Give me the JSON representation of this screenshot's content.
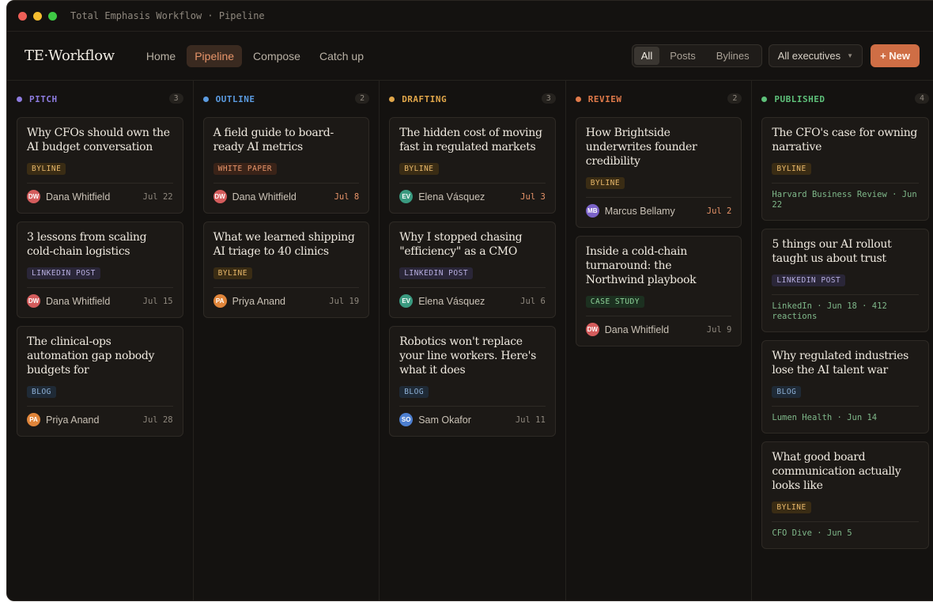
{
  "window": {
    "title": "Total Emphasis Workflow · Pipeline"
  },
  "nav": {
    "brand": "TE·Workflow",
    "links": [
      "Home",
      "Pipeline",
      "Compose",
      "Catch up"
    ],
    "active": "Pipeline"
  },
  "filters": {
    "segments": [
      "All",
      "Posts",
      "Bylines"
    ],
    "selected_segment": "All",
    "executive_select": "All executives",
    "new_button": "+ New"
  },
  "colors": {
    "accent": "#cf6e45",
    "pitch": "#8e7ce0",
    "outline": "#5b9be0",
    "drafting": "#e0a64a",
    "review": "#e07a4a",
    "published": "#5ec07a"
  },
  "columns": [
    {
      "name": "PITCH",
      "count": "3",
      "color": "#8e7ce0",
      "cards": [
        {
          "title": "Why CFOs should own the AI budget conversation",
          "tag": "BYLINE",
          "tag_type": "byline",
          "author": "Dana Whitfield",
          "initials": "DW",
          "avatar": "dw",
          "date": "Jul 22",
          "date_soon": false
        },
        {
          "title": "3 lessons from scaling cold-chain logistics",
          "tag": "LINKEDIN POST",
          "tag_type": "linkedin",
          "author": "Dana Whitfield",
          "initials": "DW",
          "avatar": "dw",
          "date": "Jul 15",
          "date_soon": false
        },
        {
          "title": "The clinical-ops automation gap nobody budgets for",
          "tag": "BLOG",
          "tag_type": "blog",
          "author": "Priya Anand",
          "initials": "PA",
          "avatar": "pa",
          "date": "Jul 28",
          "date_soon": false
        }
      ]
    },
    {
      "name": "OUTLINE",
      "count": "2",
      "color": "#5b9be0",
      "cards": [
        {
          "title": "A field guide to board-ready AI metrics",
          "tag": "WHITE PAPER",
          "tag_type": "whitepaper",
          "author": "Dana Whitfield",
          "initials": "DW",
          "avatar": "dw",
          "date": "Jul 8",
          "date_soon": true
        },
        {
          "title": "What we learned shipping AI triage to 40 clinics",
          "tag": "BYLINE",
          "tag_type": "byline",
          "author": "Priya Anand",
          "initials": "PA",
          "avatar": "pa",
          "date": "Jul 19",
          "date_soon": false
        }
      ]
    },
    {
      "name": "DRAFTING",
      "count": "3",
      "color": "#e0a64a",
      "cards": [
        {
          "title": "The hidden cost of moving fast in regulated markets",
          "tag": "BYLINE",
          "tag_type": "byline",
          "author": "Elena Vásquez",
          "initials": "EV",
          "avatar": "ev",
          "date": "Jul 3",
          "date_soon": true
        },
        {
          "title": "Why I stopped chasing \"efficiency\" as a CMO",
          "tag": "LINKEDIN POST",
          "tag_type": "linkedin",
          "author": "Elena Vásquez",
          "initials": "EV",
          "avatar": "ev",
          "date": "Jul 6",
          "date_soon": false
        },
        {
          "title": "Robotics won't replace your line workers. Here's what it does",
          "tag": "BLOG",
          "tag_type": "blog",
          "author": "Sam Okafor",
          "initials": "SO",
          "avatar": "so",
          "date": "Jul 11",
          "date_soon": false
        }
      ]
    },
    {
      "name": "REVIEW",
      "count": "2",
      "color": "#e07a4a",
      "cards": [
        {
          "title": "How Brightside underwrites founder credibility",
          "tag": "BYLINE",
          "tag_type": "byline",
          "author": "Marcus Bellamy",
          "initials": "MB",
          "avatar": "mb",
          "date": "Jul 2",
          "date_soon": true
        },
        {
          "title": "Inside a cold-chain turnaround: the Northwind playbook",
          "tag": "CASE STUDY",
          "tag_type": "casestudy",
          "author": "Dana Whitfield",
          "initials": "DW",
          "avatar": "dw",
          "date": "Jul 9",
          "date_soon": false
        }
      ]
    },
    {
      "name": "PUBLISHED",
      "count": "4",
      "color": "#5ec07a",
      "cards": [
        {
          "title": "The CFO's case for owning narrative",
          "tag": "BYLINE",
          "tag_type": "byline",
          "meta": "Harvard Business Review · Jun 22"
        },
        {
          "title": "5 things our AI rollout taught us about trust",
          "tag": "LINKEDIN POST",
          "tag_type": "linkedin",
          "meta": "LinkedIn · Jun 18 · 412 reactions"
        },
        {
          "title": "Why regulated industries lose the AI talent war",
          "tag": "BLOG",
          "tag_type": "blog",
          "meta": "Lumen Health · Jun 14"
        },
        {
          "title": "What good board communication actually looks like",
          "tag": "BYLINE",
          "tag_type": "byline",
          "meta": "CFO Dive · Jun 5"
        }
      ]
    }
  ]
}
